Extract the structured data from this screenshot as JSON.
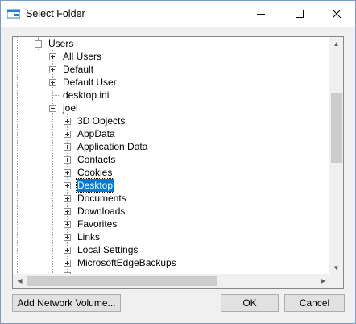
{
  "window": {
    "title": "Select Folder"
  },
  "titlebar": {
    "minimize_icon": "minimize-icon",
    "maximize_icon": "maximize-icon",
    "close_icon": "close-icon"
  },
  "tree": {
    "items": [
      {
        "label": "Users",
        "expanded": true
      },
      {
        "label": "All Users",
        "expanded": false
      },
      {
        "label": "Default",
        "expanded": false
      },
      {
        "label": "Default User",
        "expanded": false
      },
      {
        "label": "desktop.ini"
      },
      {
        "label": "joel",
        "expanded": true
      },
      {
        "label": "3D Objects",
        "expanded": false
      },
      {
        "label": "AppData",
        "expanded": false
      },
      {
        "label": "Application Data",
        "expanded": false
      },
      {
        "label": "Contacts",
        "expanded": false
      },
      {
        "label": "Cookies",
        "expanded": false
      },
      {
        "label": "Desktop",
        "expanded": false,
        "selected": true
      },
      {
        "label": "Documents",
        "expanded": false
      },
      {
        "label": "Downloads",
        "expanded": false
      },
      {
        "label": "Favorites",
        "expanded": false
      },
      {
        "label": "Links",
        "expanded": false
      },
      {
        "label": "Local Settings",
        "expanded": false
      },
      {
        "label": "MicrosoftEdgeBackups",
        "expanded": false
      }
    ]
  },
  "buttons": {
    "add_network": "Add Network Volume...",
    "ok": "OK",
    "cancel": "Cancel"
  },
  "colors": {
    "selection": "#0078d7",
    "title_bar": "#ffffff",
    "dialog_bg": "#f0f0f0"
  }
}
